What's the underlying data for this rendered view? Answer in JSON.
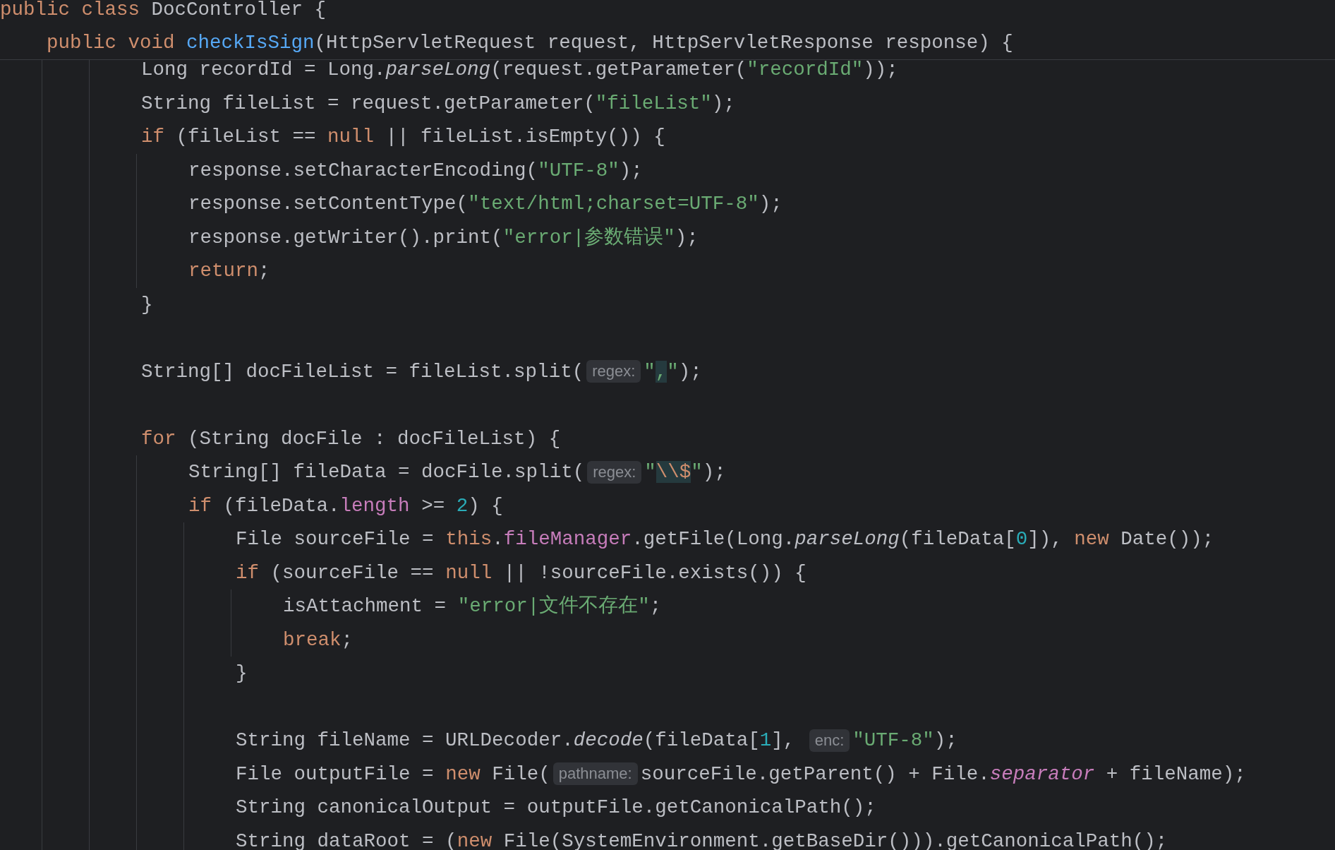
{
  "sticky_header": {
    "tokens": [
      {
        "text": "public class ",
        "kind": "kw"
      },
      {
        "text": "DocController {",
        "kind": "p"
      }
    ],
    "children": [
      {
        "tokens": [
          {
            "text": "public void ",
            "kind": "kw"
          },
          {
            "text": "checkIsSign",
            "kind": "decl"
          },
          {
            "text": "(HttpServletRequest request, HttpServletResponse response) {",
            "kind": "p"
          }
        ]
      }
    ]
  },
  "code": [
    {
      "kind": "block",
      "children": [
        {
          "kind": "block",
          "children": [
            {
              "kind": "line",
              "tokens": [
                {
                  "text": "Long recordId = Long.",
                  "kind": "p"
                },
                {
                  "text": "parseLong",
                  "kind": "it"
                },
                {
                  "text": "(request.getParameter(",
                  "kind": "p"
                },
                {
                  "text": "\"recordId\"",
                  "kind": "str"
                },
                {
                  "text": "));",
                  "kind": "p"
                }
              ]
            },
            {
              "kind": "line",
              "tokens": [
                {
                  "text": "String fileList = request.getParameter(",
                  "kind": "p"
                },
                {
                  "text": "\"fileList\"",
                  "kind": "str"
                },
                {
                  "text": ");",
                  "kind": "p"
                }
              ]
            },
            {
              "kind": "line",
              "tokens": [
                {
                  "text": "if",
                  "kind": "kw"
                },
                {
                  "text": " (fileList == ",
                  "kind": "p"
                },
                {
                  "text": "null",
                  "kind": "kw"
                },
                {
                  "text": " || fileList.isEmpty()) {",
                  "kind": "p"
                }
              ]
            },
            {
              "kind": "block",
              "children": [
                {
                  "kind": "line",
                  "tokens": [
                    {
                      "text": "response.setCharacterEncoding(",
                      "kind": "p"
                    },
                    {
                      "text": "\"UTF-8\"",
                      "kind": "str"
                    },
                    {
                      "text": ");",
                      "kind": "p"
                    }
                  ]
                },
                {
                  "kind": "line",
                  "tokens": [
                    {
                      "text": "response.setContentType(",
                      "kind": "p"
                    },
                    {
                      "text": "\"text/html;charset=UTF-8\"",
                      "kind": "str"
                    },
                    {
                      "text": ");",
                      "kind": "p"
                    }
                  ]
                },
                {
                  "kind": "line",
                  "tokens": [
                    {
                      "text": "response.getWriter().print(",
                      "kind": "p"
                    },
                    {
                      "text": "\"error|参数错误\"",
                      "kind": "str"
                    },
                    {
                      "text": ");",
                      "kind": "p"
                    }
                  ]
                },
                {
                  "kind": "line",
                  "tokens": [
                    {
                      "text": "return",
                      "kind": "kw"
                    },
                    {
                      "text": ";",
                      "kind": "p"
                    }
                  ]
                }
              ]
            },
            {
              "kind": "line",
              "tokens": [
                {
                  "text": "}",
                  "kind": "p"
                }
              ]
            },
            {
              "kind": "blank"
            },
            {
              "kind": "line",
              "tokens": [
                {
                  "text": "String[] docFileList = fileList.split(",
                  "kind": "p"
                },
                {
                  "text": "regex:",
                  "kind": "hint"
                },
                {
                  "text": "\"",
                  "kind": "str"
                },
                {
                  "text": ",",
                  "kind": "rxs"
                },
                {
                  "text": "\"",
                  "kind": "str"
                },
                {
                  "text": ");",
                  "kind": "p"
                }
              ]
            },
            {
              "kind": "blank"
            },
            {
              "kind": "line",
              "tokens": [
                {
                  "text": "for",
                  "kind": "kw"
                },
                {
                  "text": " (String docFile : docFileList) {",
                  "kind": "p"
                }
              ]
            },
            {
              "kind": "block",
              "children": [
                {
                  "kind": "line",
                  "tokens": [
                    {
                      "text": "String[] fileData = docFile.split(",
                      "kind": "p"
                    },
                    {
                      "text": "regex:",
                      "kind": "hint"
                    },
                    {
                      "text": "\"",
                      "kind": "str"
                    },
                    {
                      "text": "\\\\$",
                      "kind": "rxe"
                    },
                    {
                      "text": "\"",
                      "kind": "str"
                    },
                    {
                      "text": ");",
                      "kind": "p"
                    }
                  ]
                },
                {
                  "kind": "line",
                  "tokens": [
                    {
                      "text": "if",
                      "kind": "kw"
                    },
                    {
                      "text": " (fileData.",
                      "kind": "p"
                    },
                    {
                      "text": "length",
                      "kind": "field"
                    },
                    {
                      "text": " >= ",
                      "kind": "p"
                    },
                    {
                      "text": "2",
                      "kind": "num"
                    },
                    {
                      "text": ") {",
                      "kind": "p"
                    }
                  ]
                },
                {
                  "kind": "block",
                  "children": [
                    {
                      "kind": "line",
                      "tokens": [
                        {
                          "text": "File sourceFile = ",
                          "kind": "p"
                        },
                        {
                          "text": "this",
                          "kind": "kw"
                        },
                        {
                          "text": ".",
                          "kind": "p"
                        },
                        {
                          "text": "fileManager",
                          "kind": "field"
                        },
                        {
                          "text": ".getFile(Long.",
                          "kind": "p"
                        },
                        {
                          "text": "parseLong",
                          "kind": "it"
                        },
                        {
                          "text": "(fileData[",
                          "kind": "p"
                        },
                        {
                          "text": "0",
                          "kind": "num"
                        },
                        {
                          "text": "]), ",
                          "kind": "p"
                        },
                        {
                          "text": "new",
                          "kind": "kw"
                        },
                        {
                          "text": " Date());",
                          "kind": "p"
                        }
                      ]
                    },
                    {
                      "kind": "line",
                      "tokens": [
                        {
                          "text": "if",
                          "kind": "kw"
                        },
                        {
                          "text": " (sourceFile == ",
                          "kind": "p"
                        },
                        {
                          "text": "null",
                          "kind": "kw"
                        },
                        {
                          "text": " || !sourceFile.exists()) {",
                          "kind": "p"
                        }
                      ]
                    },
                    {
                      "kind": "block",
                      "children": [
                        {
                          "kind": "line",
                          "tokens": [
                            {
                              "text": "isAttachment = ",
                              "kind": "p"
                            },
                            {
                              "text": "\"error|文件不存在\"",
                              "kind": "str"
                            },
                            {
                              "text": ";",
                              "kind": "p"
                            }
                          ]
                        },
                        {
                          "kind": "line",
                          "tokens": [
                            {
                              "text": "break",
                              "kind": "kw"
                            },
                            {
                              "text": ";",
                              "kind": "p"
                            }
                          ]
                        }
                      ]
                    },
                    {
                      "kind": "line",
                      "tokens": [
                        {
                          "text": "}",
                          "kind": "p"
                        }
                      ]
                    },
                    {
                      "kind": "blank"
                    },
                    {
                      "kind": "line",
                      "tokens": [
                        {
                          "text": "String fileName = URLDecoder.",
                          "kind": "p"
                        },
                        {
                          "text": "decode",
                          "kind": "it"
                        },
                        {
                          "text": "(fileData[",
                          "kind": "p"
                        },
                        {
                          "text": "1",
                          "kind": "num"
                        },
                        {
                          "text": "], ",
                          "kind": "p"
                        },
                        {
                          "text": "enc:",
                          "kind": "hint"
                        },
                        {
                          "text": "\"UTF-8\"",
                          "kind": "str"
                        },
                        {
                          "text": ");",
                          "kind": "p"
                        }
                      ]
                    },
                    {
                      "kind": "line",
                      "tokens": [
                        {
                          "text": "File outputFile = ",
                          "kind": "p"
                        },
                        {
                          "text": "new",
                          "kind": "kw"
                        },
                        {
                          "text": " File(",
                          "kind": "p"
                        },
                        {
                          "text": "pathname:",
                          "kind": "hint"
                        },
                        {
                          "text": "sourceFile.getParent() + File.",
                          "kind": "p"
                        },
                        {
                          "text": "separator",
                          "kind": "static"
                        },
                        {
                          "text": " + fileName);",
                          "kind": "p"
                        }
                      ]
                    },
                    {
                      "kind": "line",
                      "tokens": [
                        {
                          "text": "String canonicalOutput = outputFile.getCanonicalPath();",
                          "kind": "p"
                        }
                      ]
                    },
                    {
                      "kind": "line",
                      "tokens": [
                        {
                          "text": "String dataRoot = (",
                          "kind": "p"
                        },
                        {
                          "text": "new",
                          "kind": "kw"
                        },
                        {
                          "text": " File(SystemEnvironment.getBaseDir())).getCanonicalPath();",
                          "kind": "p"
                        }
                      ]
                    }
                  ]
                }
              ]
            }
          ]
        }
      ]
    }
  ]
}
